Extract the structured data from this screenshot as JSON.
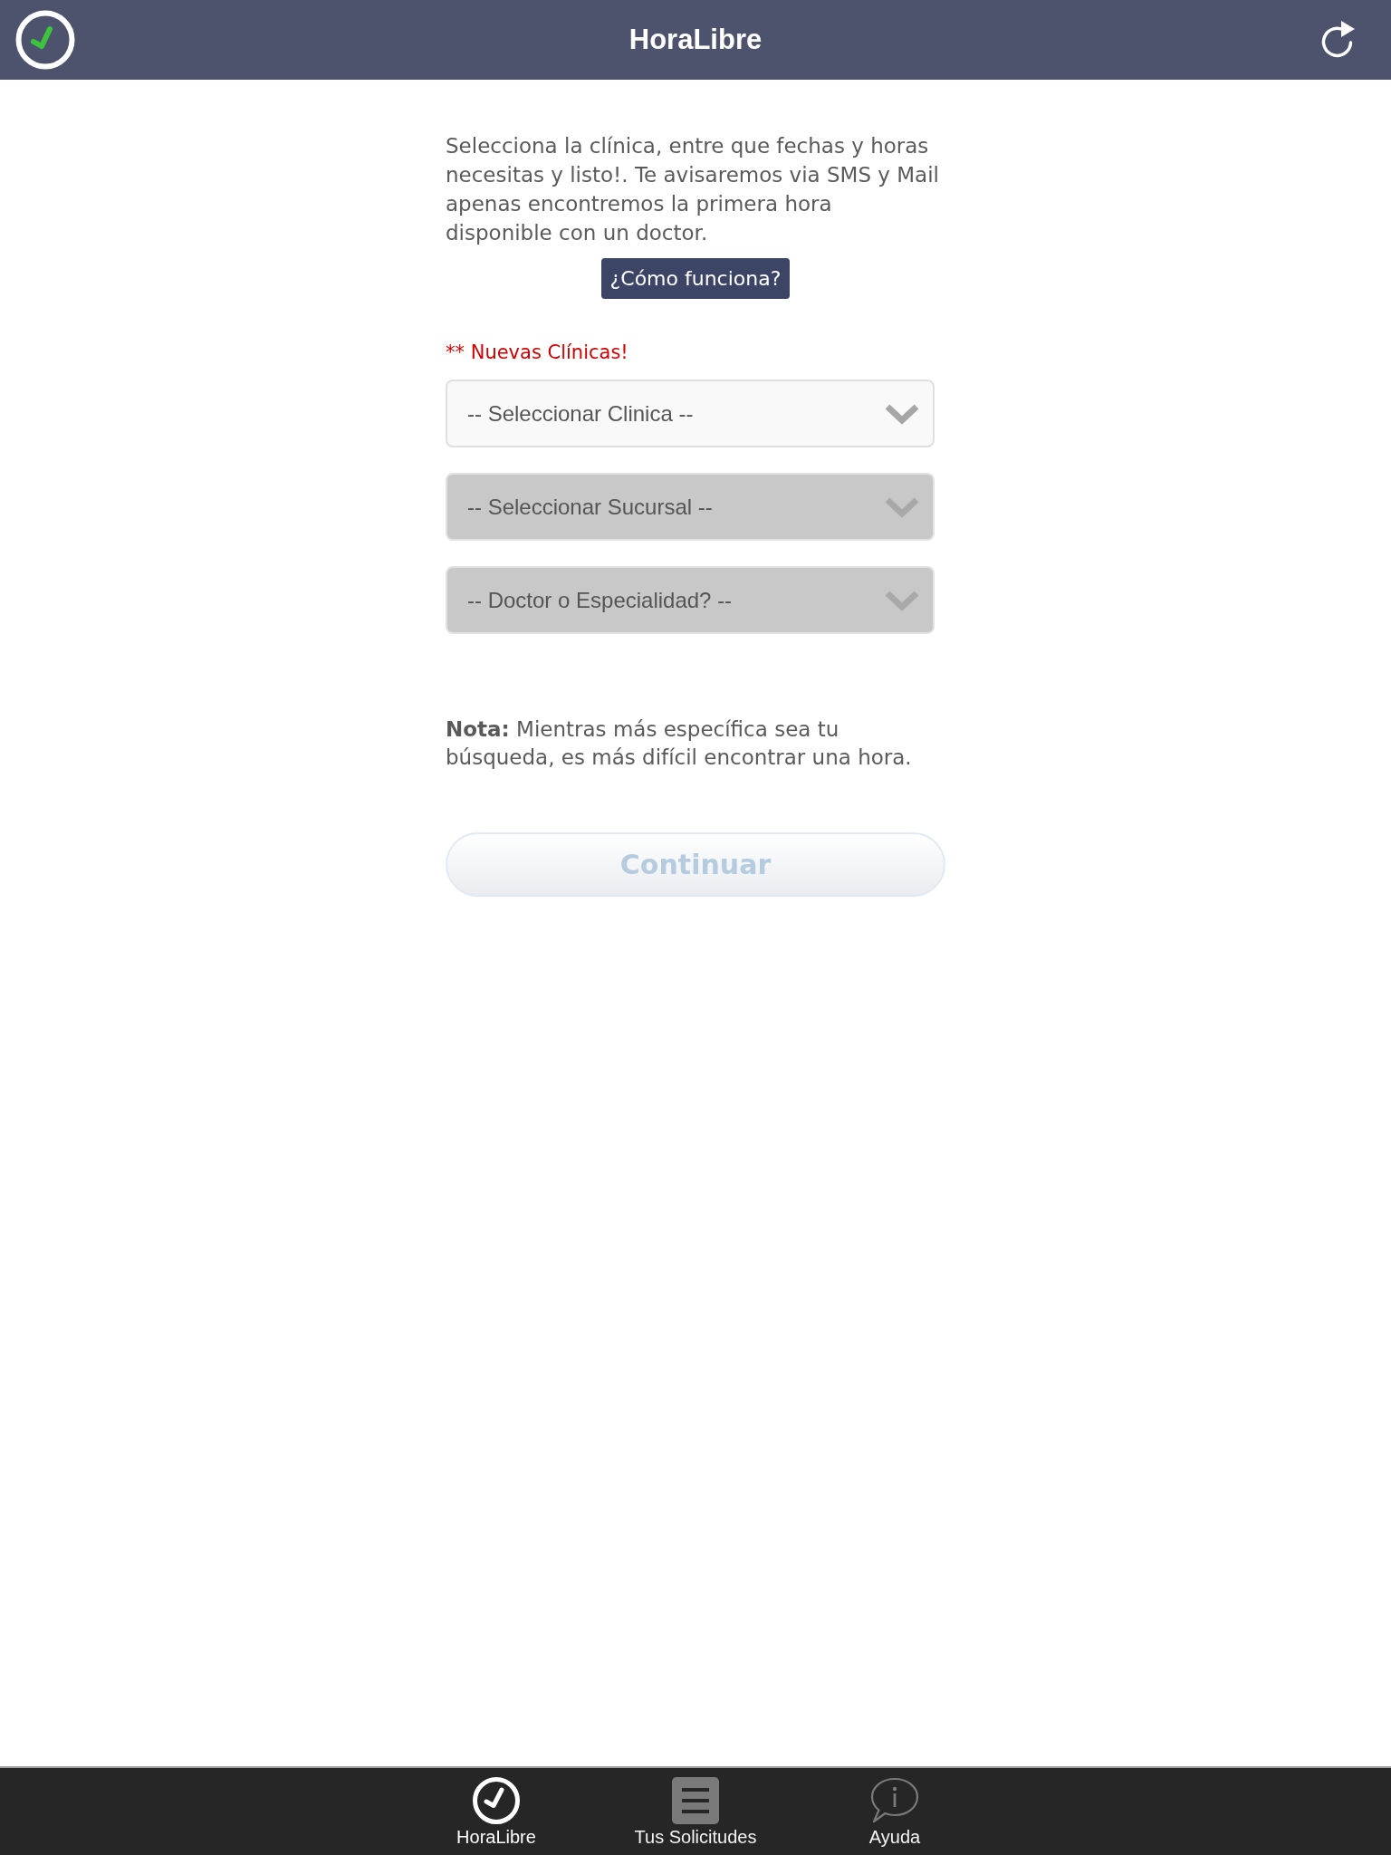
{
  "header": {
    "title": "HoraLibre"
  },
  "intro": {
    "text": "Selecciona la clínica, entre que fechas y horas necesitas y listo!. Te avisaremos via SMS y Mail apenas encontremos la primera hora disponible con un doctor.",
    "help_button": "¿Cómo funciona?"
  },
  "notice": "** Nuevas Clínicas!",
  "selects": [
    {
      "label": "-- Seleccionar Clinica --",
      "disabled": false
    },
    {
      "label": "-- Seleccionar Sucursal --",
      "disabled": true
    },
    {
      "label": "-- Doctor o Especialidad? --",
      "disabled": true
    }
  ],
  "note": "**Nota:** Mientras más específica sea tu búsqueda, es más difícil encontrar una hora.",
  "continue_button": {
    "label": "Continuar",
    "disabled": true
  },
  "tab_bar": [
    {
      "kind": "check",
      "label": "HoraLibre",
      "selected": true
    },
    {
      "kind": "list",
      "label": "Tus Solicitudes",
      "selected": false
    },
    {
      "kind": "info",
      "label": "Ayuda",
      "selected": false
    }
  ]
}
